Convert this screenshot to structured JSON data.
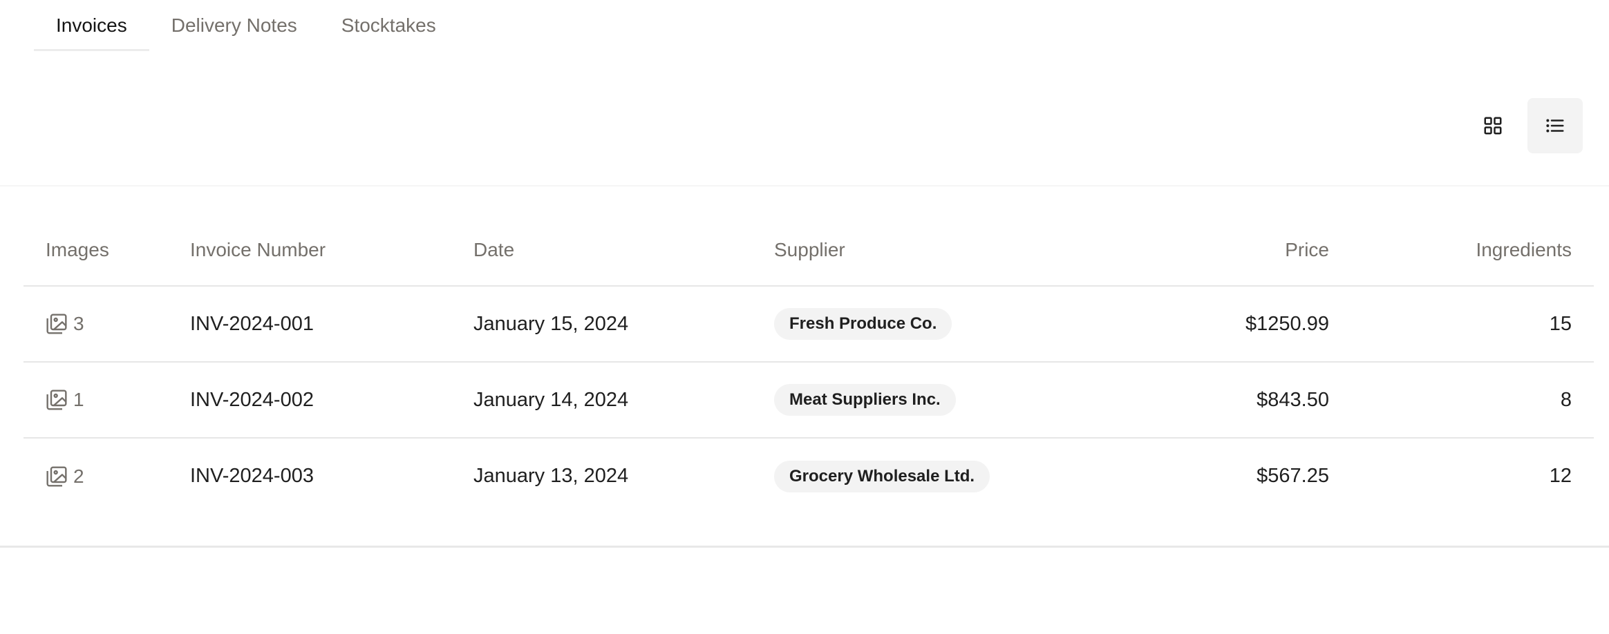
{
  "tabs": [
    {
      "label": "Invoices",
      "active": true
    },
    {
      "label": "Delivery Notes",
      "active": false
    },
    {
      "label": "Stocktakes",
      "active": false
    }
  ],
  "view_toggle": {
    "options": [
      {
        "name": "grid-icon",
        "active": false
      },
      {
        "name": "list-icon",
        "active": true
      }
    ]
  },
  "table": {
    "headers": {
      "images": "Images",
      "invoice_number": "Invoice Number",
      "date": "Date",
      "supplier": "Supplier",
      "price": "Price",
      "ingredients": "Ingredients"
    },
    "rows": [
      {
        "images": "3",
        "invoice_number": "INV-2024-001",
        "date": "January 15, 2024",
        "supplier": "Fresh Produce Co.",
        "price": "$1250.99",
        "ingredients": "15"
      },
      {
        "images": "1",
        "invoice_number": "INV-2024-002",
        "date": "January 14, 2024",
        "supplier": "Meat Suppliers Inc.",
        "price": "$843.50",
        "ingredients": "8"
      },
      {
        "images": "2",
        "invoice_number": "INV-2024-003",
        "date": "January 13, 2024",
        "supplier": "Grocery Wholesale Ltd.",
        "price": "$567.25",
        "ingredients": "12"
      }
    ]
  },
  "colors": {
    "muted_text": "#74706b",
    "badge_bg": "#f3f3f3",
    "border": "#e6e6e6"
  }
}
